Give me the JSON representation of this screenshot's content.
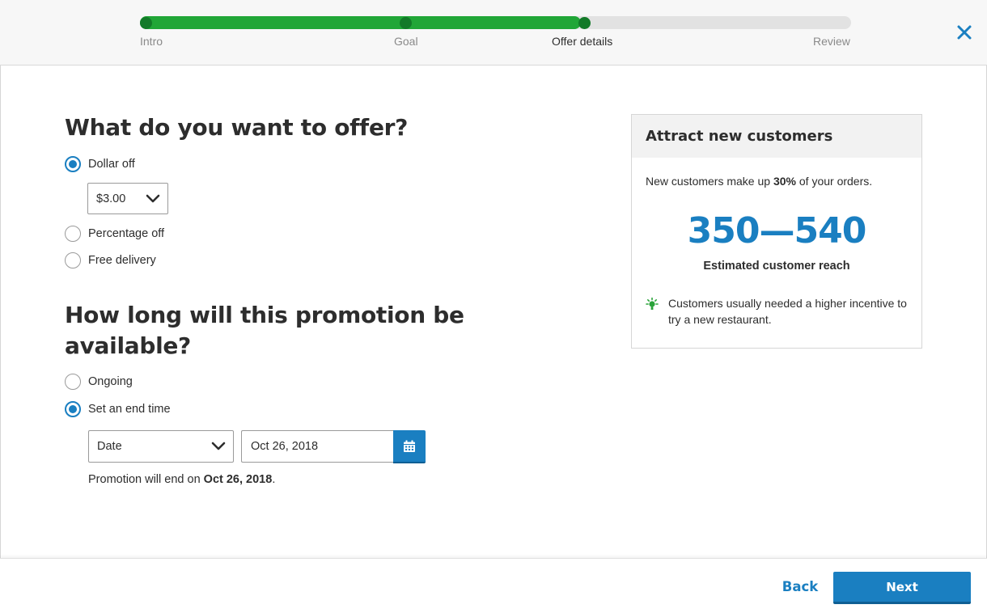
{
  "progress": {
    "steps": [
      {
        "label": "Intro",
        "completed": true
      },
      {
        "label": "Goal",
        "completed": true
      },
      {
        "label": "Offer details",
        "completed": true,
        "active": true
      },
      {
        "label": "Review",
        "completed": false
      }
    ],
    "fill_fraction": 0.62,
    "colors": {
      "fill": "#21a637",
      "dot": "#137a29",
      "track": "#e2e2e2"
    }
  },
  "close_icon": "close-x-icon",
  "offer": {
    "title": "What do you want to offer?",
    "options": [
      {
        "label": "Dollar off",
        "checked": true
      },
      {
        "label": "Percentage off",
        "checked": false
      },
      {
        "label": "Free delivery",
        "checked": false
      }
    ],
    "amount_select": {
      "value": "$3.00"
    }
  },
  "duration": {
    "title": "How long will this promotion be available?",
    "options": [
      {
        "label": "Ongoing",
        "checked": false
      },
      {
        "label": "Set an end time",
        "checked": true
      }
    ],
    "type_select": {
      "value": "Date"
    },
    "date_input": {
      "value": "Oct 26, 2018"
    },
    "note_prefix": "Promotion will end on ",
    "note_date": "Oct 26, 2018",
    "note_suffix": "."
  },
  "card": {
    "title": "Attract new customers",
    "text_prefix": "New customers make up ",
    "text_percent": "30%",
    "text_suffix": " of your orders.",
    "reach_value": "350—540",
    "reach_label": "Estimated customer reach",
    "tip_icon": "lightbulb-icon",
    "tip_text": "Customers usually needed a higher incentive to try a new restaurant."
  },
  "footer": {
    "back_label": "Back",
    "next_label": "Next"
  },
  "colors": {
    "accent": "#1a7fc1",
    "progress_green": "#21a637",
    "tip_green": "#2aa33a"
  }
}
